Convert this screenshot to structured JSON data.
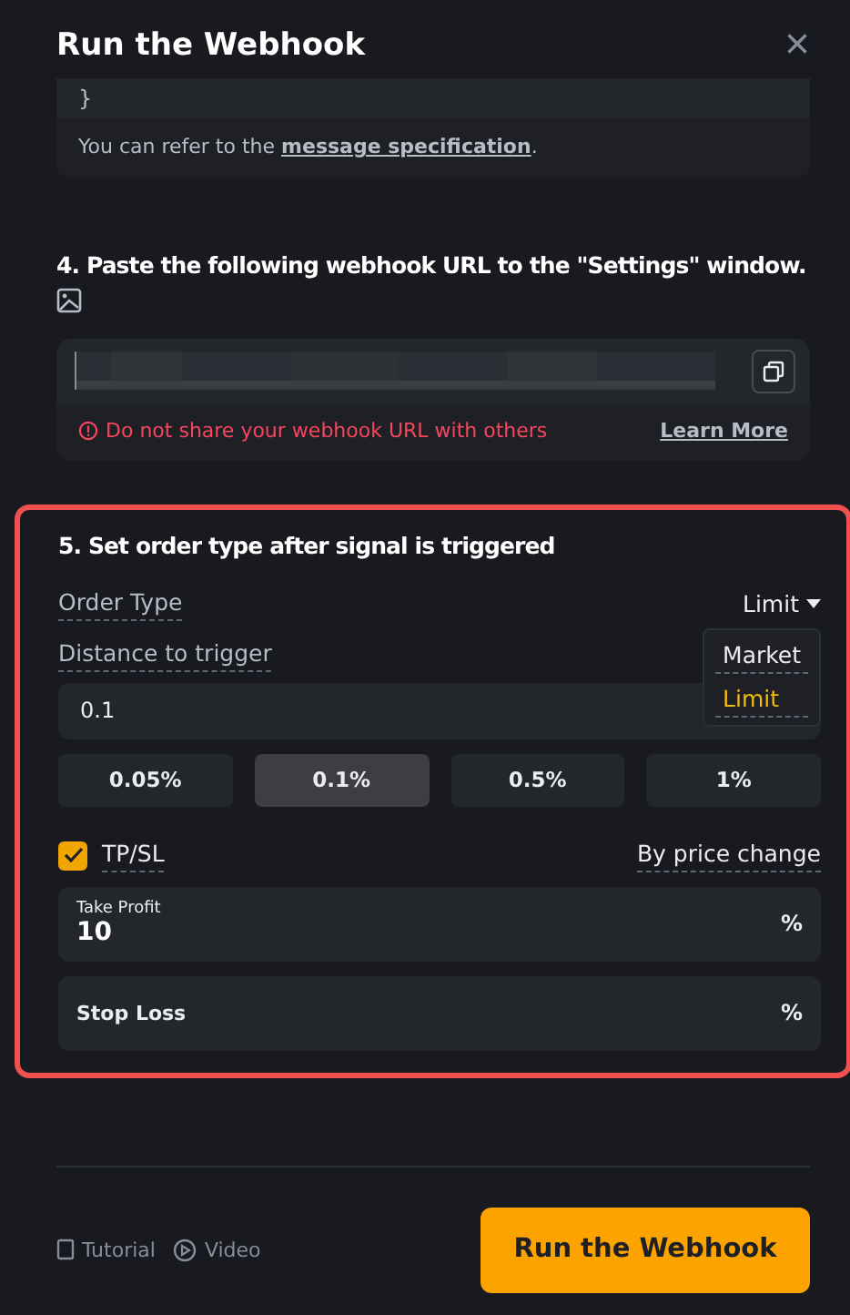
{
  "dialog": {
    "title": "Run the Webhook",
    "close": "×"
  },
  "code_block": {
    "last_line": "}",
    "note": "You can refer to the ",
    "link": "message specification",
    "note_end": "."
  },
  "step4": {
    "heading": "4. Paste the following webhook URL to the \"Settings\" window.",
    "warning": "Do not share your webhook URL with others",
    "learn_more": "Learn More"
  },
  "step5": {
    "heading": "5. Set order type after signal is triggered",
    "highlighted": true,
    "order_type": {
      "label": "Order Type",
      "value": "Limit",
      "expanded": true,
      "options": [
        {
          "label": "Market",
          "selected": false
        },
        {
          "label": "Limit",
          "selected": true
        }
      ]
    },
    "distance": {
      "label": "Distance to trigger",
      "value": "0.1"
    },
    "presets": [
      {
        "label": "0.05%",
        "selected": false
      },
      {
        "label": "0.1%",
        "selected": true
      },
      {
        "label": "0.5%",
        "selected": false
      },
      {
        "label": "1%",
        "selected": false
      }
    ],
    "tpsl": {
      "label": "TP/SL",
      "checked": true,
      "mode": "By price change"
    },
    "take_profit": {
      "label": "Take Profit",
      "value": "10",
      "unit": "%"
    },
    "stop_loss": {
      "placeholder": "Stop Loss",
      "unit": "%"
    }
  },
  "footer": {
    "tutorial": "Tutorial",
    "video": "Video",
    "primary": "Run the Webhook"
  }
}
